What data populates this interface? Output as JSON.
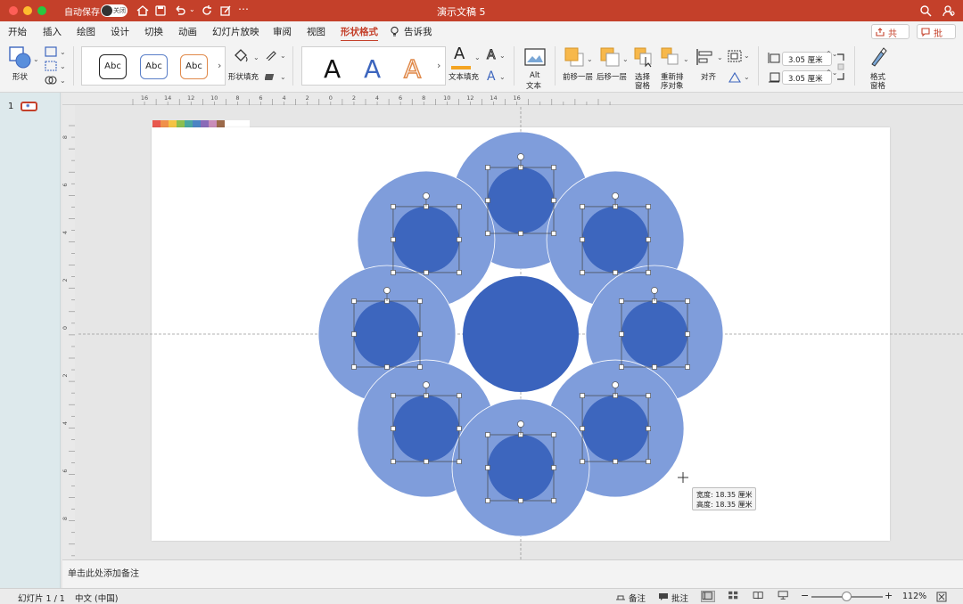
{
  "titlebar": {
    "autosave_label": "自动保存",
    "autosave_state": "关闭",
    "doc_title": "演示文稿 5",
    "more": "⋯"
  },
  "tabs": [
    {
      "label": "开始"
    },
    {
      "label": "插入"
    },
    {
      "label": "绘图"
    },
    {
      "label": "设计"
    },
    {
      "label": "切换"
    },
    {
      "label": "动画"
    },
    {
      "label": "幻灯片放映"
    },
    {
      "label": "审阅"
    },
    {
      "label": "视图"
    },
    {
      "label": "形状格式"
    },
    {
      "label": "告诉我"
    }
  ],
  "active_tab": "形状格式",
  "share_label": "共享",
  "comment_label": "批注",
  "ribbon": {
    "shape_label": "形状",
    "style_samples": [
      "Abc",
      "Abc",
      "Abc"
    ],
    "shape_fill_label": "形状填充",
    "wordart_letters": [
      "A",
      "A",
      "A"
    ],
    "text_fill_label": "文本填充",
    "alt_text_label_1": "Alt",
    "alt_text_label_2": "文本",
    "bring_forward_label": "前移一层",
    "send_backward_label": "后移一层",
    "selection_pane_label_1": "选择",
    "selection_pane_label_2": "窗格",
    "reorder_label_1": "重新排",
    "reorder_label_2": "序对象",
    "align_label": "对齐",
    "height_value": "3.05 厘米",
    "width_value": "3.05 厘米",
    "format_pane_label_1": "格式",
    "format_pane_label_2": "窗格"
  },
  "ruler_top_labels": [
    "16",
    "14",
    "12",
    "10",
    "8",
    "6",
    "4",
    "2",
    "0",
    "2",
    "4",
    "6",
    "8",
    "10",
    "12",
    "14",
    "16"
  ],
  "ruler_left_labels": [
    "8",
    "6",
    "4",
    "2",
    "0",
    "2",
    "4",
    "6",
    "8"
  ],
  "thumbnail": {
    "number": "1"
  },
  "swatch_colors": [
    "#e8574d",
    "#f0904a",
    "#f5c344",
    "#8cbf4f",
    "#4aa7a0",
    "#4b84c4",
    "#8a6bb8",
    "#c98db9",
    "#9c6a4a"
  ],
  "colors": {
    "outer_circle": "#7f9ddb",
    "inner_circle": "#3d66be",
    "center_circle": "#3a63bd",
    "accent": "#c4402a"
  },
  "tooltip": {
    "width_line": "宽度: 18.35 厘米",
    "height_line": "高度: 18.35 厘米"
  },
  "notes_placeholder": "单击此处添加备注",
  "status": {
    "slide_counter": "幻灯片 1 / 1",
    "language": "中文 (中国)",
    "notes_label": "备注",
    "comments_label": "批注",
    "zoom_minus": "−",
    "zoom_plus": "+",
    "zoom_level": "112%"
  }
}
